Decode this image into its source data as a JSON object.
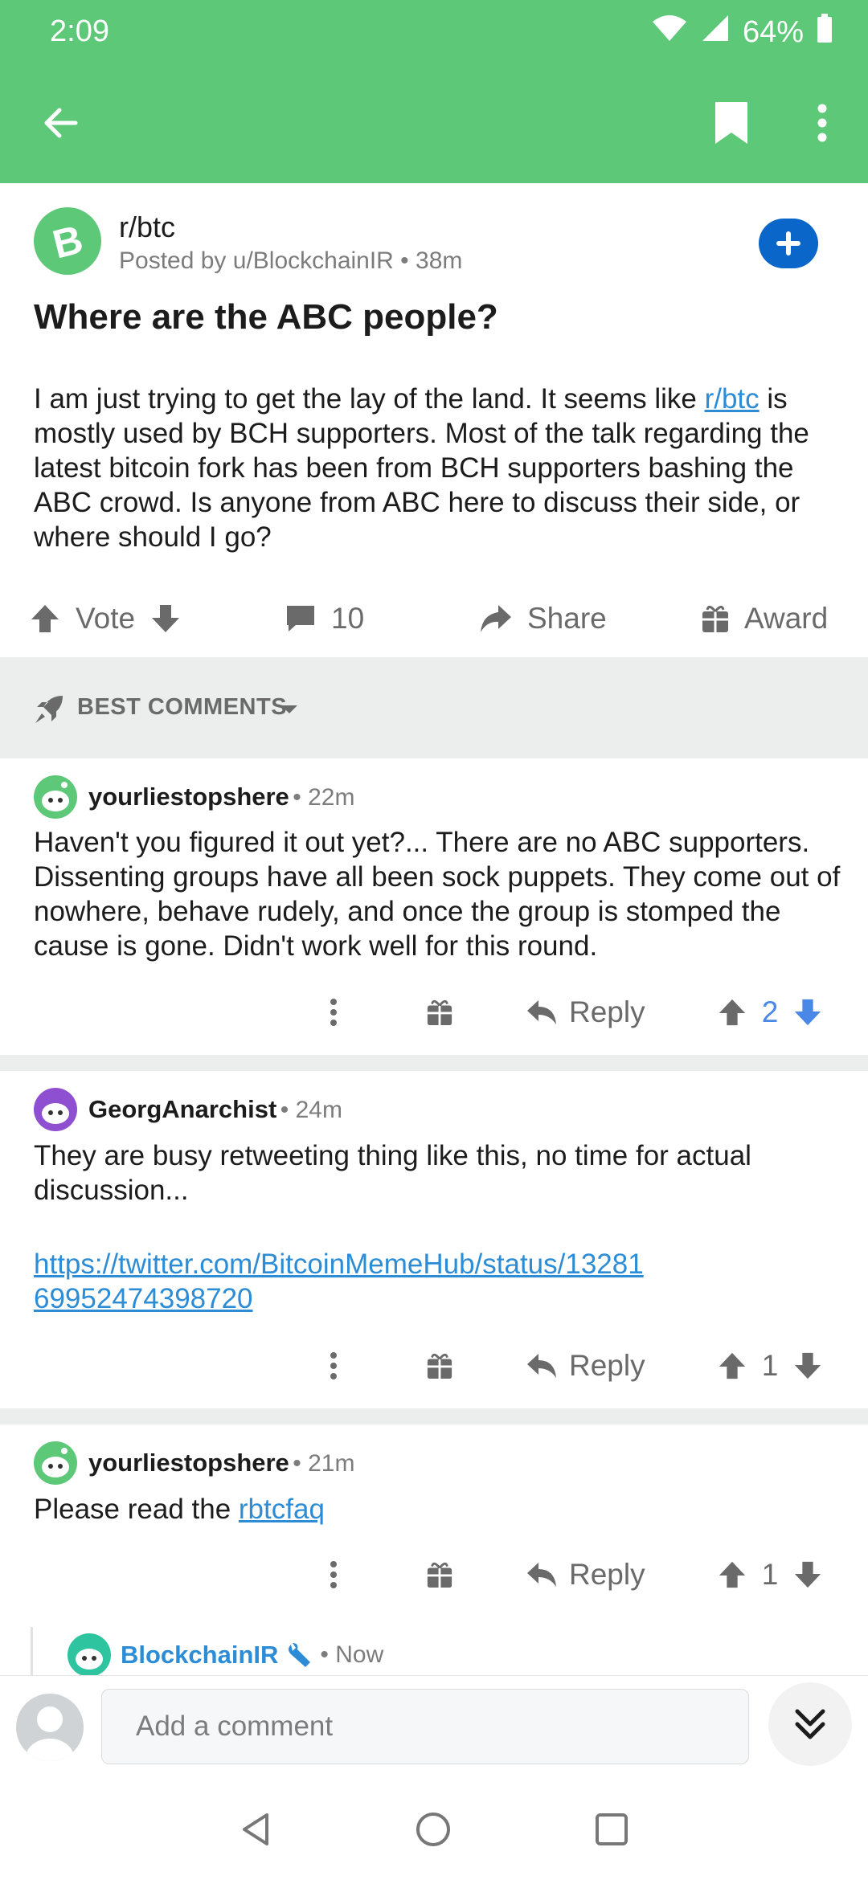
{
  "status_bar": {
    "time": "2:09",
    "battery": "64%"
  },
  "toolbar": {
    "back_icon": "arrow-left-icon",
    "bookmark_icon": "bookmark-icon",
    "more_icon": "more-vert-icon"
  },
  "post": {
    "subreddit": "r/btc",
    "meta": "Posted by u/BlockchainIR • 38m",
    "title": "Where are the ABC people?",
    "body_before_link": "I am just trying to get the lay of the land. It seems like ",
    "body_link": "r/btc",
    "body_after_link": " is mostly used by BCH supporters. Most of the talk regarding the latest bitcoin fork has been from BCH supporters bashing the ABC crowd. Is anyone from ABC here to discuss their side, or where should I go?",
    "vote_label": "Vote",
    "comment_count": "10",
    "share_label": "Share",
    "award_label": "Award"
  },
  "sort": {
    "label": "BEST COMMENTS"
  },
  "comments": [
    {
      "author": "yourliestopshere",
      "time": "• 22m",
      "body": "Haven't you figured it out yet?... There are no ABC supporters. Dissenting groups have all been sock puppets.  They come out of nowhere, behave rudely, and once the group is stomped the cause is gone.  Didn't work well for this round.",
      "reply_label": "Reply",
      "score": "2"
    },
    {
      "author": "GeorgAnarchist",
      "time": "• 24m",
      "body": "They are busy retweeting thing like this, no time for actual discussion...",
      "link": "https://twitter.com/BitcoinMemeHub/status/1328169952474398720",
      "reply_label": "Reply",
      "score": "1"
    },
    {
      "author": "yourliestopshere",
      "time": "• 21m",
      "body_before_link": "Please read the ",
      "link": "rbtcfaq",
      "reply_label": "Reply",
      "score": "1"
    },
    {
      "author": "BlockchainIR",
      "time": "• Now"
    }
  ],
  "comment_bar": {
    "placeholder": "Add a comment"
  },
  "colors": {
    "header": "#5dc878",
    "link": "#2c8cd6",
    "upvoted": "#4a88e8",
    "join_button": "#0a66c8"
  }
}
